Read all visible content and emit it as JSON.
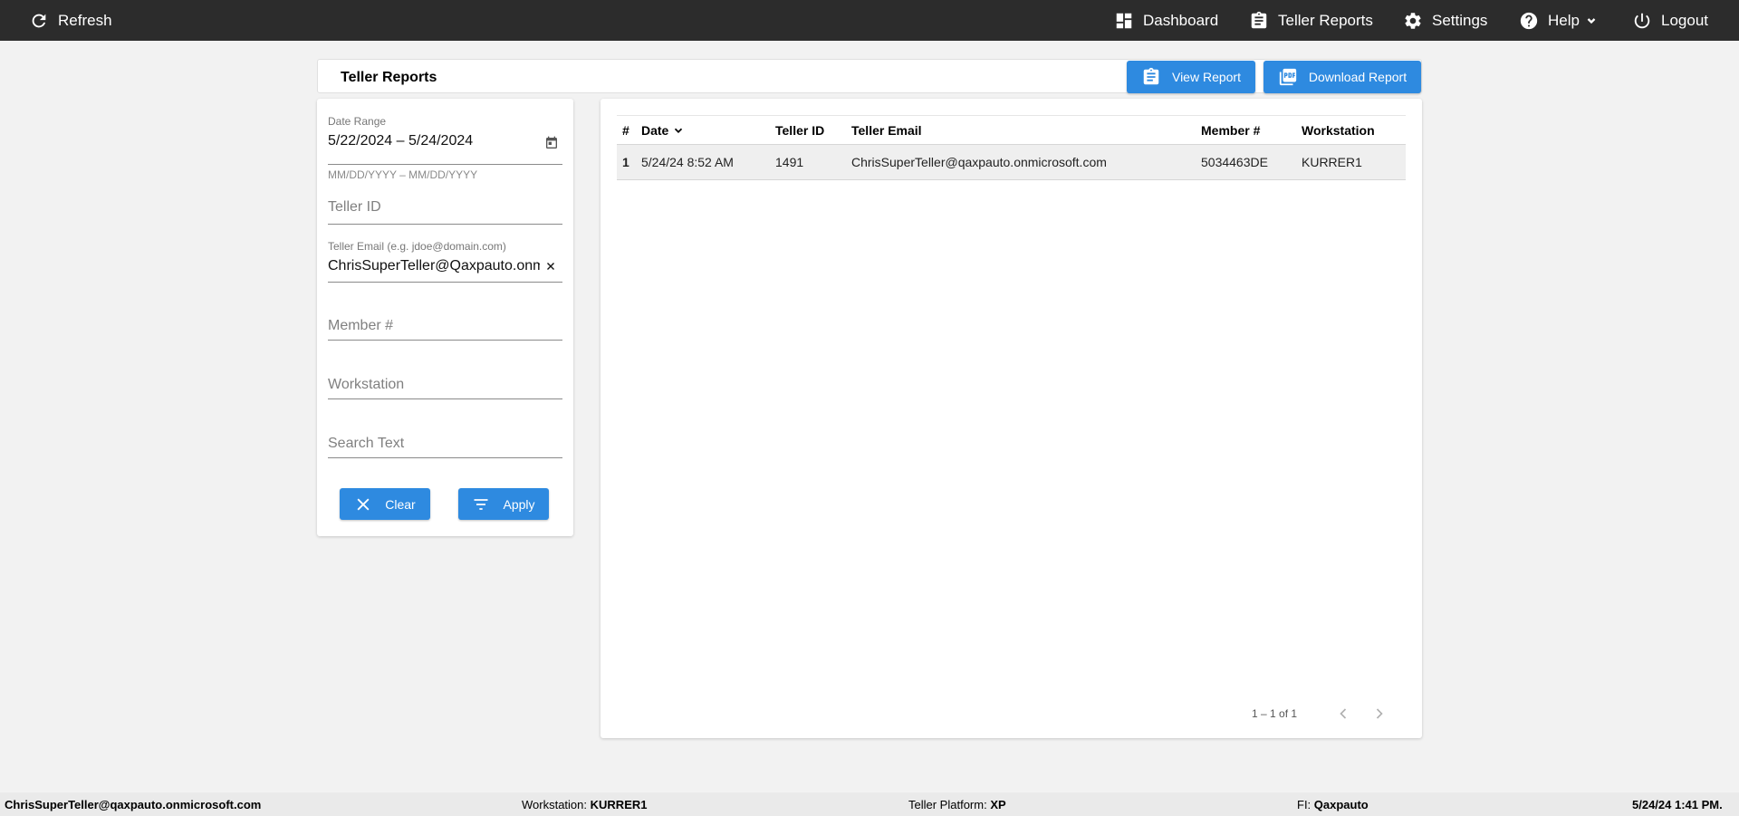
{
  "topbar": {
    "refresh": "Refresh",
    "dashboard": "Dashboard",
    "teller_reports": "Teller Reports",
    "settings": "Settings",
    "help": "Help",
    "logout": "Logout"
  },
  "header": {
    "title": "Teller Reports",
    "view_report": "View Report",
    "download_report": "Download Report"
  },
  "filters": {
    "date_range_label": "Date Range",
    "date_range_value": "5/22/2024 – 5/24/2024",
    "date_hint": "MM/DD/YYYY – MM/DD/YYYY",
    "teller_id_placeholder": "Teller ID",
    "teller_email_label": "Teller Email (e.g. jdoe@domain.com)",
    "teller_email_value": "ChrisSuperTeller@Qaxpauto.onmicrosoft.com",
    "member_placeholder": "Member #",
    "workstation_placeholder": "Workstation",
    "search_placeholder": "Search Text",
    "clear_label": "Clear",
    "apply_label": "Apply"
  },
  "table": {
    "columns": [
      "#",
      "Date",
      "Teller ID",
      "Teller Email",
      "Member #",
      "Workstation"
    ],
    "rows": [
      {
        "num": "1",
        "date": "5/24/24 8:52 AM",
        "teller_id": "1491",
        "teller_email": "ChrisSuperTeller@qaxpauto.onmicrosoft.com",
        "member": "5034463DE",
        "workstation": "KURRER1"
      }
    ],
    "paginator": "1 – 1 of 1"
  },
  "status": {
    "user": "ChrisSuperTeller@qaxpauto.onmicrosoft.com",
    "workstation_label": "Workstation:",
    "workstation_value": "KURRER1",
    "platform_label": "Teller Platform:",
    "platform_value": "XP",
    "fi_label": "FI:",
    "fi_value": "Qaxpauto",
    "datetime": "5/24/24 1:41 PM."
  },
  "colors": {
    "topbar": "#2c2c2c",
    "accent": "#2e8ae0",
    "background": "#f2f2f2"
  }
}
